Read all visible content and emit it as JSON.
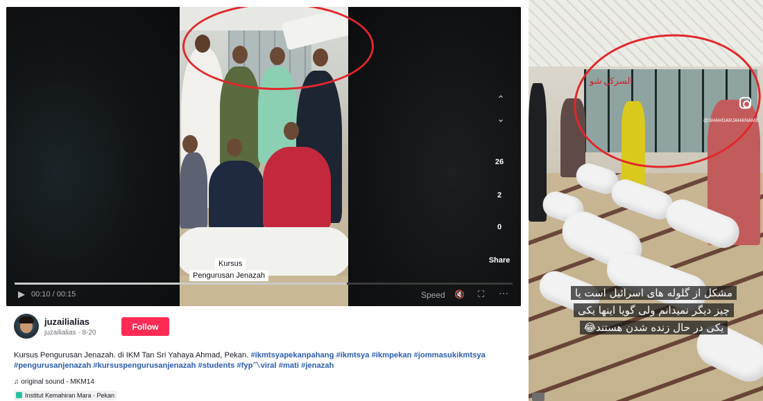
{
  "player": {
    "overlay_caption_line1": "Kursus",
    "overlay_caption_line2": "Pengurusan Jenazah",
    "time": "00:10 / 00:15",
    "progress": 0.6667,
    "speed_label": "Speed",
    "volume_icon": "volume-muted-icon",
    "fullscreen_icon": "fullscreen-icon",
    "more_icon": "more-icon",
    "play_icon": "play-icon",
    "rail": {
      "up_icon": "chevron-up-icon",
      "down_icon": "chevron-down-icon",
      "likes": "26",
      "comments": "2",
      "saves": "0",
      "share_label": "Share"
    }
  },
  "author": {
    "username": "juzailialias",
    "sub": "juzailialias · 8-20",
    "follow_label": "Follow",
    "description_text": "Kursus Pengurusan Jenazah. di IKM Tan Sri Yahaya Ahmad, Pekan.",
    "hashtags_line1": [
      "#ikmtsyapekanpahang",
      "#ikmtsya",
      "#ikmpekan",
      "#jommasukikmtsya"
    ],
    "hashtags_line2": [
      "#pengurusanjenazah",
      "#kursuspengurusanjenazah",
      "#students",
      "#fyp〽viral",
      "#mati",
      "#jenazah"
    ],
    "sound": "♫ original sound - MKM14",
    "location": "Institut Kemahiran Mara · Pekan"
  },
  "right_panel": {
    "persian_line1": "مشکل از گلوله های اسرائیل است یا",
    "persian_line2": "چیز دیگر نمیدانم ولی گویا اینها یکی",
    "persian_line3": "یکی در حال زنده شدن هستند😂",
    "watermark": "@SHAHDARJAHANAM3",
    "arabic_overlay": "السرکۍ شو",
    "instagram_icon": "instagram-icon"
  },
  "colors": {
    "follow_button": "#fe2c55",
    "hashtag": "#2b5db0",
    "annotation_circle": "#e3262b"
  }
}
